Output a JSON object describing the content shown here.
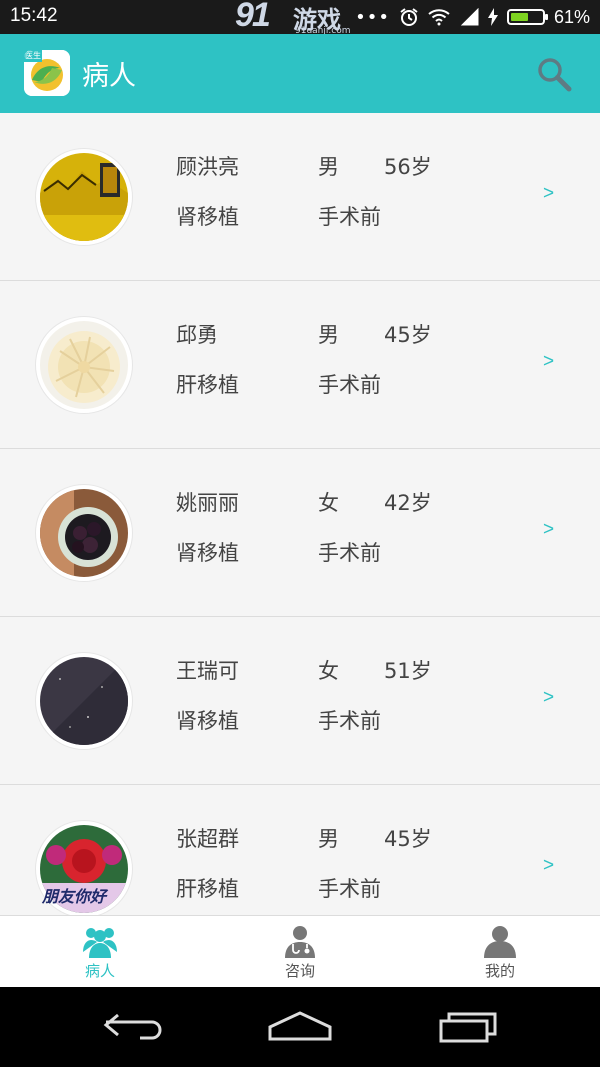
{
  "status_bar": {
    "time": "15:42",
    "watermark": {
      "big": "91",
      "cn": "游戏",
      "url": "91danji.com"
    },
    "dots": "•••",
    "battery_percent": "61%",
    "battery_level": 0.61,
    "icons": [
      "alarm-icon",
      "wifi-icon",
      "signal-icon",
      "charging-icon",
      "battery-icon"
    ]
  },
  "app_bar": {
    "title": "病人",
    "logo_badge": "医生",
    "search_icon": "search-icon",
    "color": "#2ec2c4"
  },
  "patients": [
    {
      "name": "顾洪亮",
      "sex": "男",
      "age": "56岁",
      "organ": "肾移植",
      "stage": "手术前",
      "chevron": ">"
    },
    {
      "name": "邱勇",
      "sex": "男",
      "age": "45岁",
      "organ": "肝移植",
      "stage": "手术前",
      "chevron": ">"
    },
    {
      "name": "姚丽丽",
      "sex": "女",
      "age": "42岁",
      "organ": "肾移植",
      "stage": "手术前",
      "chevron": ">"
    },
    {
      "name": "王瑞可",
      "sex": "女",
      "age": "51岁",
      "organ": "肾移植",
      "stage": "手术前",
      "chevron": ">"
    },
    {
      "name": "张超群",
      "sex": "男",
      "age": "45岁",
      "organ": "肝移植",
      "stage": "手术前",
      "chevron": ">",
      "avatar_text": "朋友你好"
    }
  ],
  "tabs": [
    {
      "label": "病人",
      "icon": "patients-icon",
      "active": true
    },
    {
      "label": "咨询",
      "icon": "doctor-consult-icon",
      "active": false
    },
    {
      "label": "我的",
      "icon": "profile-icon",
      "active": false
    }
  ],
  "colors": {
    "accent": "#2ec2c4",
    "inactive": "#777777",
    "row_bg": "#f5f5f5"
  },
  "nav_bar": {
    "icons": [
      "back-icon",
      "home-icon",
      "recents-icon"
    ]
  }
}
